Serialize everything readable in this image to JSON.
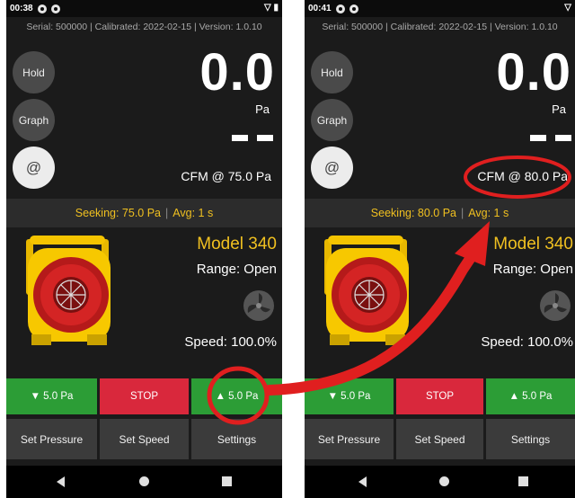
{
  "left": {
    "status_time": "00:38",
    "serial": "Serial: 500000",
    "calibrated": "Calibrated: 2022-02-15",
    "version": "Version: 1.0.10",
    "hold_label": "Hold",
    "graph_label": "Graph",
    "at_label": "@",
    "pressure_value": "0.0",
    "pressure_unit": "Pa",
    "cfm_label": "CFM @ 75.0 Pa",
    "seeking": "Seeking: 75.0 Pa",
    "avg": "Avg: 1 s",
    "model": "Model 340",
    "range": "Range: Open",
    "speed": "Speed: 100.0%",
    "decrease_label": "▼ 5.0 Pa",
    "stop_label": "STOP",
    "increase_label": "▲ 5.0 Pa",
    "set_pressure": "Set Pressure",
    "set_speed": "Set Speed",
    "settings": "Settings"
  },
  "right": {
    "status_time": "00:41",
    "serial": "Serial: 500000",
    "calibrated": "Calibrated: 2022-02-15",
    "version": "Version: 1.0.10",
    "hold_label": "Hold",
    "graph_label": "Graph",
    "at_label": "@",
    "pressure_value": "0.0",
    "pressure_unit": "Pa",
    "cfm_label": "CFM @ 80.0 Pa",
    "seeking": "Seeking: 80.0 Pa",
    "avg": "Avg: 1 s",
    "model": "Model 340",
    "range": "Range: Open",
    "speed": "Speed: 100.0%",
    "decrease_label": "▼ 5.0 Pa",
    "stop_label": "STOP",
    "increase_label": "▲ 5.0 Pa",
    "set_pressure": "Set Pressure",
    "set_speed": "Set Speed",
    "settings": "Settings"
  },
  "colors": {
    "accent_yellow": "#f0c020",
    "button_green": "#2c9d36",
    "button_red": "#d9283c",
    "annotation_red": "#e01f1f"
  }
}
